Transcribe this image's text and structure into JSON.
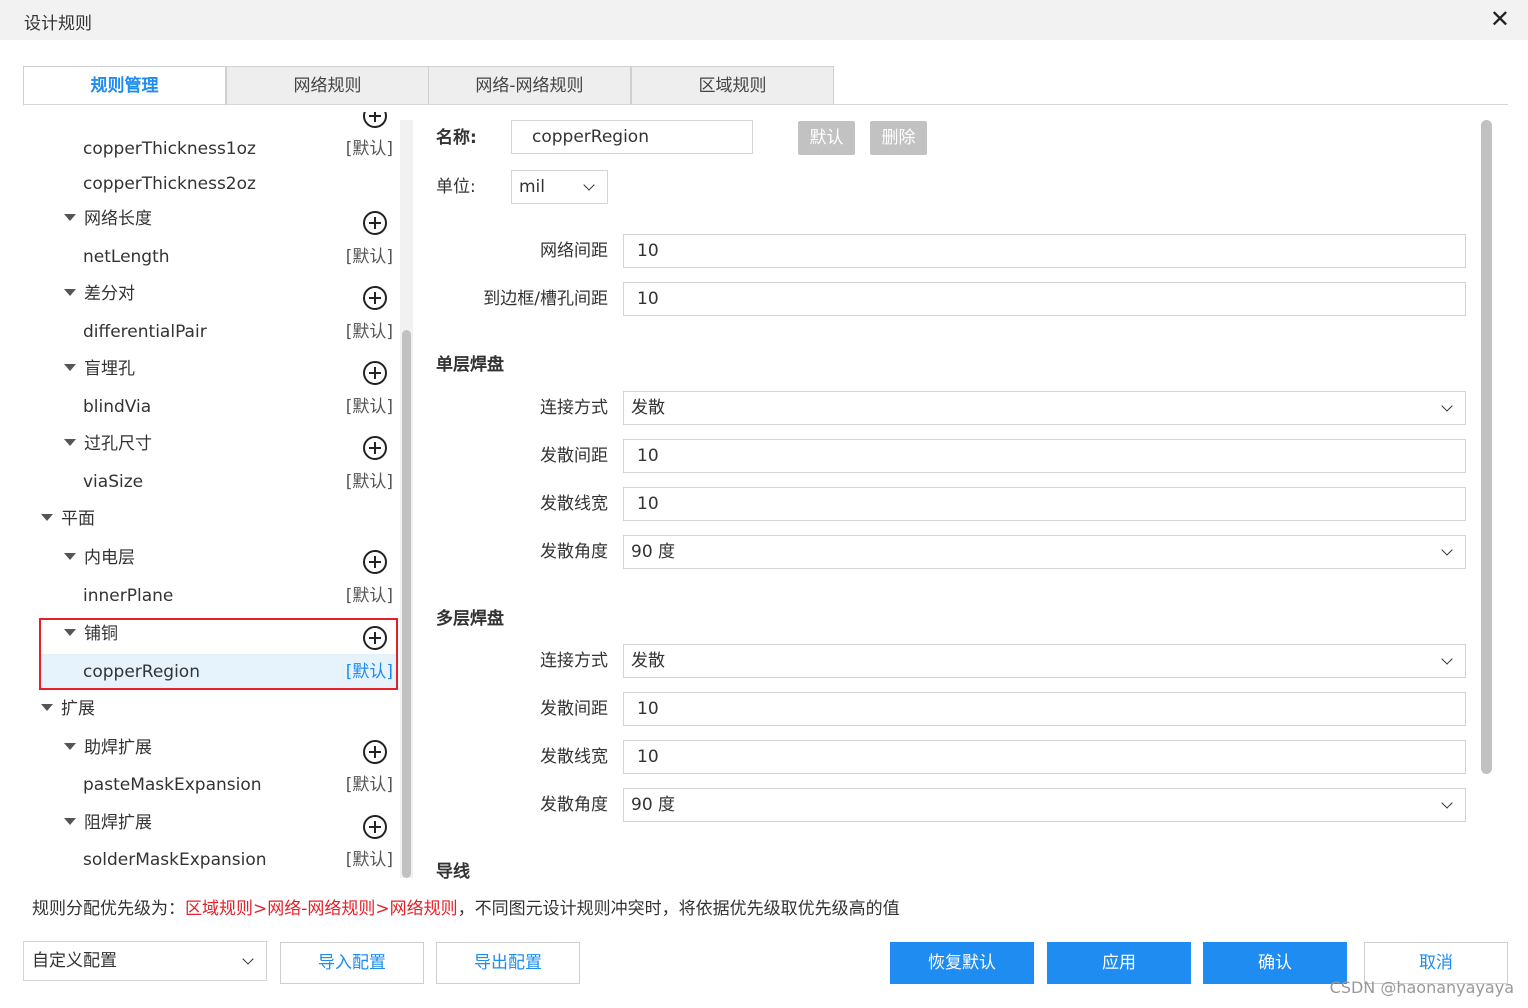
{
  "window": {
    "title": "设计规则",
    "close_glyph": "✕"
  },
  "tabs": [
    {
      "label": "规则管理",
      "active": true
    },
    {
      "label": "网络规则",
      "active": false
    },
    {
      "label": "网络-网络规则",
      "active": false
    },
    {
      "label": "区域规则",
      "active": false
    }
  ],
  "tree": {
    "default_tag": "[默认]",
    "items": {
      "copperThickness1oz": "copperThickness1oz",
      "copperThickness2oz": "copperThickness2oz",
      "netLengthGroup": "网络长度",
      "netLength": "netLength",
      "diffPairGroup": "差分对",
      "differentialPair": "differentialPair",
      "blindViaGroup": "盲埋孔",
      "blindVia": "blindVia",
      "viaSizeGroup": "过孔尺寸",
      "viaSize": "viaSize",
      "planeCategory": "平面",
      "innerPlaneGroup": "内电层",
      "innerPlane": "innerPlane",
      "copperPourGroup": "铺铜",
      "copperRegion": "copperRegion",
      "expansionCategory": "扩展",
      "pasteMaskGroup": "助焊扩展",
      "pasteMaskExpansion": "pasteMaskExpansion",
      "solderMaskGroup": "阻焊扩展",
      "solderMaskExpansion": "solderMaskExpansion"
    },
    "selected": "copperRegion"
  },
  "form": {
    "name_label": "名称:",
    "name_value": "copperRegion",
    "default_btn": "默认",
    "delete_btn": "删除",
    "unit_label": "单位:",
    "unit_value": "mil",
    "net_spacing_label": "网络间距",
    "net_spacing_value": "10",
    "board_spacing_label": "到边框/槽孔间距",
    "board_spacing_value": "10",
    "single_layer_title": "单层焊盘",
    "single": {
      "connect_label": "连接方式",
      "connect_value": "发散",
      "spoke_gap_label": "发散间距",
      "spoke_gap_value": "10",
      "spoke_width_label": "发散线宽",
      "spoke_width_value": "10",
      "spoke_angle_label": "发散角度",
      "spoke_angle_value": "90 度"
    },
    "multi_layer_title": "多层焊盘",
    "multi": {
      "connect_label": "连接方式",
      "connect_value": "发散",
      "spoke_gap_label": "发散间距",
      "spoke_gap_value": "10",
      "spoke_width_label": "发散线宽",
      "spoke_width_value": "10",
      "spoke_angle_label": "发散角度",
      "spoke_angle_value": "90 度"
    },
    "wire_title": "导线"
  },
  "note": {
    "prefix": "规则分配优先级为：",
    "priority": "区域规则>网络-网络规则>网络规则",
    "suffix": "，不同图元设计规则冲突时，将依据优先级取优先级高的值"
  },
  "footer": {
    "config_value": "自定义配置",
    "import_btn": "导入配置",
    "export_btn": "导出配置",
    "restore_btn": "恢复默认",
    "apply_btn": "应用",
    "confirm_btn": "确认",
    "cancel_btn": "取消"
  },
  "watermark": "CSDN @haonanyayaya",
  "colors": {
    "accent": "#1e8cf0",
    "highlight_box": "#e5202a",
    "selected_row": "#e6f3fd"
  }
}
